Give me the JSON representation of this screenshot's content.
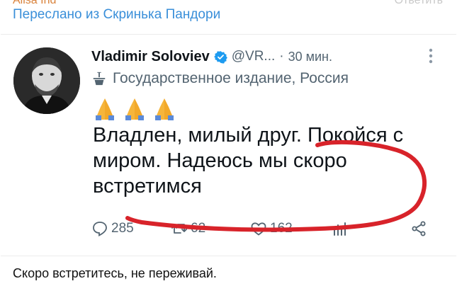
{
  "header": {
    "author": "Alisa Ind",
    "reply_label": "Ответить",
    "forwarded_from": "Переслано из Скринька Пандори"
  },
  "tweet": {
    "author_name": "Vladimir Soloviev",
    "handle": "@VR...",
    "separator": "·",
    "time": "30 мин.",
    "affiliation": "Государственное издание, Россия",
    "text": "Владлен, милый друг. Покойся с миром. Надеюсь мы скоро встретимся",
    "emoji": [
      "folded-hands",
      "folded-hands",
      "folded-hands"
    ],
    "replies": "285",
    "retweets": "62",
    "likes": "162"
  },
  "caption": "Скоро встретитесь, не переживай.",
  "colors": {
    "link_blue": "#3a8fd9",
    "author_orange": "#d9823b",
    "scribble_red": "#d8232a",
    "verified_blue": "#1d9bf0",
    "muted_gray": "#536471"
  }
}
